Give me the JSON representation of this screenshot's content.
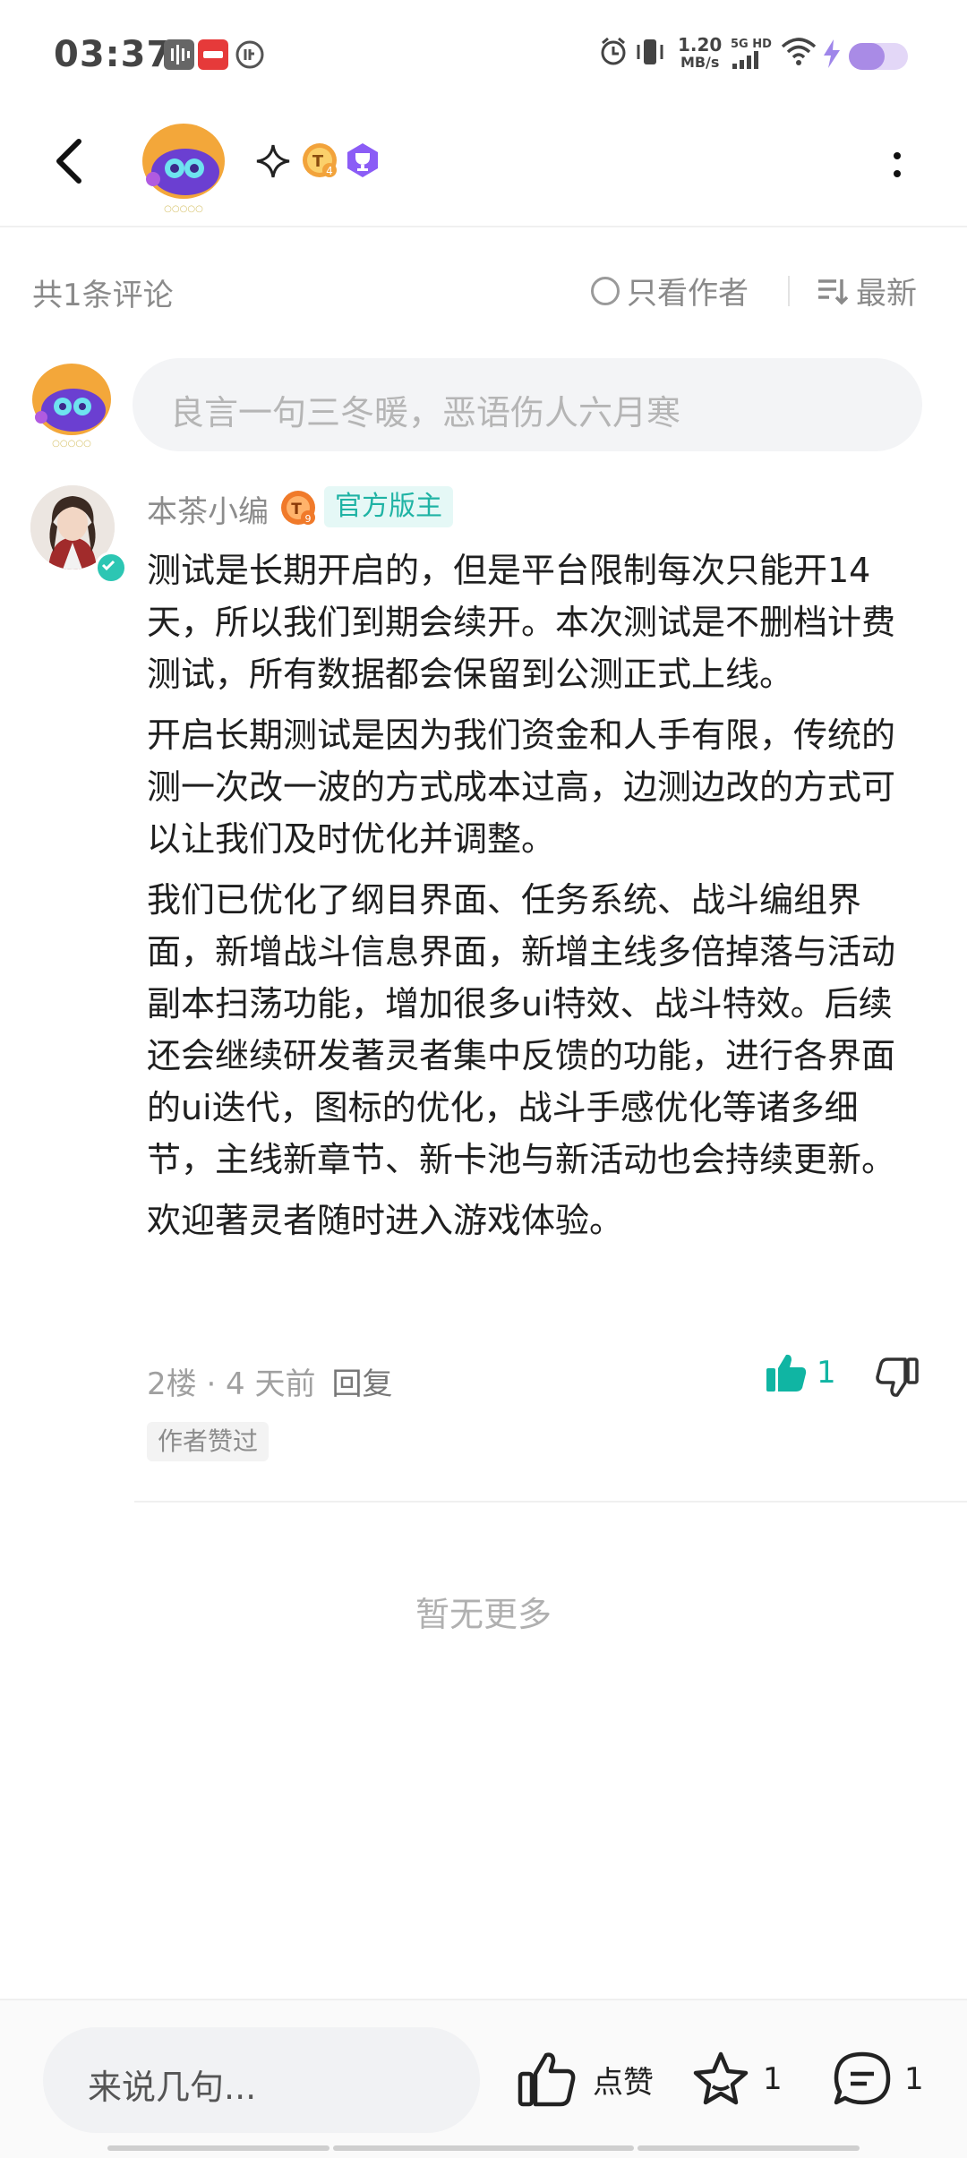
{
  "status_bar": {
    "time": "03:37",
    "net_speed_value": "1.20",
    "net_speed_unit": "MB/s",
    "network": "5G HD",
    "battery_level": 0.6,
    "icons": [
      "soundwave-icon",
      "app-notification-icon",
      "circle-app-icon",
      "alarm-icon",
      "vibrate-icon",
      "signal-icon",
      "wifi-icon",
      "charging-icon",
      "battery-icon"
    ]
  },
  "header": {
    "back_icon": "back-arrow-icon",
    "more_icon": "more-vertical-icon"
  },
  "sort_bar": {
    "count_label": "共1条评论",
    "only_author_label": "只看作者",
    "latest_label": "最新"
  },
  "comment_input": {
    "placeholder": "良言一句三冬暖，恶语伤人六月寒"
  },
  "comment": {
    "author": "本茶小编",
    "role_badge": "官方版主",
    "paragraphs": [
      "测试是长期开启的，但是平台限制每次只能开14天，所以我们到期会续开。本次测试是不删档计费测试，所有数据都会保留到公测正式上线。",
      "开启长期测试是因为我们资金和人手有限，传统的测一次改一波的方式成本过高，边测边改的方式可以让我们及时优化并调整。",
      "我们已优化了纲目界面、任务系统、战斗编组界面，新增战斗信息界面，新增主线多倍掉落与活动副本扫荡功能，增加很多ui特效、战斗特效。后续还会继续研发著灵者集中反馈的功能，进行各界面的ui迭代，图标的优化，战斗手感优化等诸多细节，主线新章节、新卡池与新活动也会持续更新。",
      "欢迎著灵者随时进入游戏体验。"
    ],
    "floor_time": "2楼 · 4 天前",
    "reply_label": "回复",
    "like_count": "1",
    "author_liked_tag": "作者赞过",
    "accent_color": "#10b5a3"
  },
  "footer_text": "暂无更多",
  "bottom_bar": {
    "input_placeholder": "来说几句...",
    "like_label": "点赞",
    "favorite_count": "1",
    "comment_count": "1"
  }
}
